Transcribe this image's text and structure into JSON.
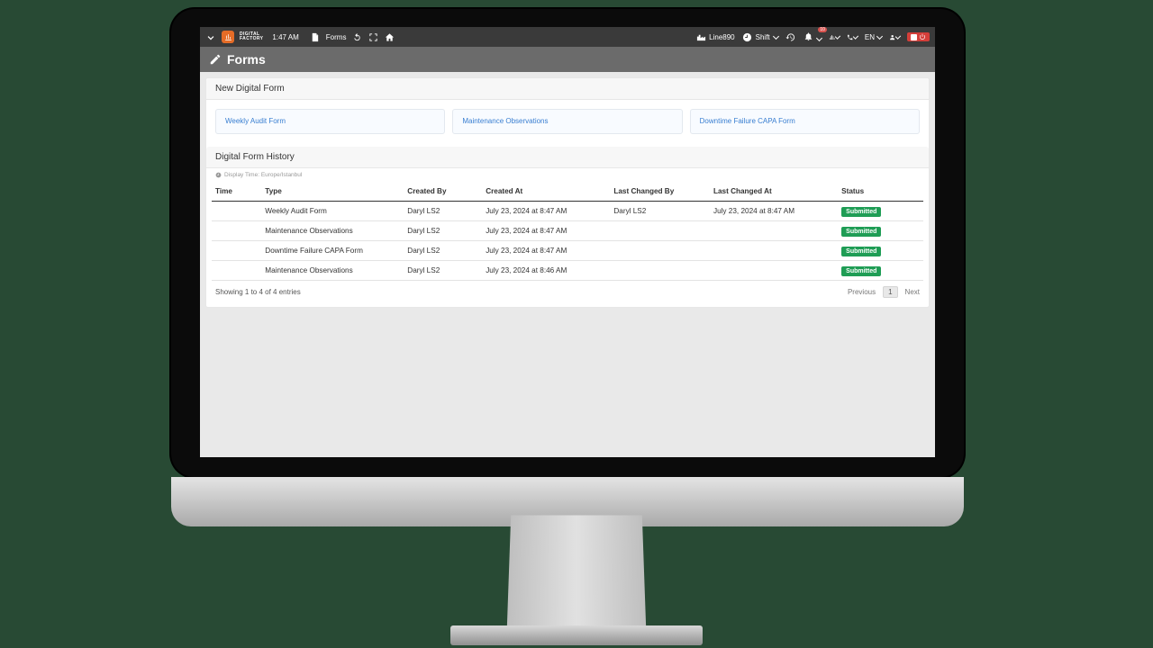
{
  "topbar": {
    "brand_line1": "DIGITAL",
    "brand_line2": "FACTORY",
    "clock": "1:47 AM",
    "nav_forms": "Forms",
    "right": {
      "line": "Line890",
      "shift": "Shift",
      "bell_count": "10",
      "lang": "EN"
    }
  },
  "header": {
    "title": "Forms"
  },
  "new_form": {
    "section_title": "New Digital Form",
    "links": [
      "Weekly Audit Form",
      "Maintenance Observations",
      "Downtime Failure CAPA Form"
    ]
  },
  "history": {
    "section_title": "Digital Form History",
    "tz_label": "Display Time: Europe/Istanbul",
    "columns": {
      "time": "Time",
      "type": "Type",
      "created_by": "Created By",
      "created_at": "Created At",
      "last_changed_by": "Last Changed By",
      "last_changed_at": "Last Changed At",
      "status": "Status"
    },
    "rows": [
      {
        "time": "",
        "type": "Weekly Audit Form",
        "created_by": "Daryl LS2",
        "created_at": "July 23, 2024 at 8:47 AM",
        "last_changed_by": "Daryl LS2",
        "last_changed_at": "July 23, 2024 at 8:47 AM",
        "status": "Submitted"
      },
      {
        "time": "",
        "type": "Maintenance Observations",
        "created_by": "Daryl LS2",
        "created_at": "July 23, 2024 at 8:47 AM",
        "last_changed_by": "",
        "last_changed_at": "",
        "status": "Submitted"
      },
      {
        "time": "",
        "type": "Downtime Failure CAPA Form",
        "created_by": "Daryl LS2",
        "created_at": "July 23, 2024 at 8:47 AM",
        "last_changed_by": "",
        "last_changed_at": "",
        "status": "Submitted"
      },
      {
        "time": "",
        "type": "Maintenance Observations",
        "created_by": "Daryl LS2",
        "created_at": "July 23, 2024 at 8:46 AM",
        "last_changed_by": "",
        "last_changed_at": "",
        "status": "Submitted"
      }
    ],
    "footer": {
      "showing": "Showing 1 to 4 of 4 entries",
      "prev": "Previous",
      "page": "1",
      "next": "Next"
    }
  }
}
